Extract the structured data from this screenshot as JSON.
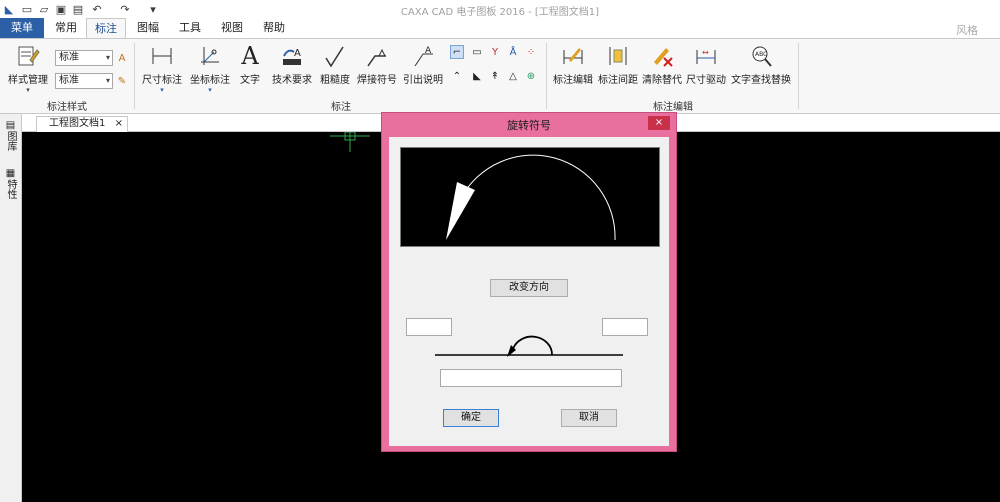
{
  "app": {
    "title": "CAXA CAD 电子图板 2016 - [工程图文档1]",
    "user_label": "风格"
  },
  "quick_access": [
    "new-file-icon",
    "open-folder-icon",
    "save-icon",
    "print-icon",
    "undo-icon",
    "redo-icon",
    "customize-icon"
  ],
  "menu": {
    "tabs": [
      {
        "label": "菜单"
      },
      {
        "label": "常用"
      },
      {
        "label": "标注"
      },
      {
        "label": "图幅"
      },
      {
        "label": "工具"
      },
      {
        "label": "视图"
      },
      {
        "label": "帮助"
      }
    ],
    "active_tab": "标注"
  },
  "ribbon": {
    "style_group": {
      "label": "标注样式",
      "manage_label": "样式管理",
      "combo1": "标准",
      "combo2": "标准"
    },
    "annot_group": {
      "label": "标注",
      "buttons": [
        {
          "label": "尺寸标注"
        },
        {
          "label": "坐标标注"
        },
        {
          "label": "文字"
        },
        {
          "label": "技术要求"
        },
        {
          "label": "粗糙度"
        },
        {
          "label": "焊接符号"
        },
        {
          "label": "引出说明"
        }
      ]
    },
    "edit_group": {
      "label": "标注编辑",
      "buttons": [
        {
          "label": "标注编辑"
        },
        {
          "label": "标注间距"
        },
        {
          "label": "清除替代"
        },
        {
          "label": "尺寸驱动"
        },
        {
          "label": "文字查找替换"
        }
      ]
    }
  },
  "document": {
    "tab_label": "工程图文档1",
    "close_label": "×"
  },
  "side_panel": {
    "tabs": [
      {
        "label": "图库"
      },
      {
        "label": "特性"
      }
    ]
  },
  "dialog": {
    "title": "旋转符号",
    "close_label": "×",
    "change_direction": "改变方向",
    "ok": "确定",
    "cancel": "取消",
    "left_value": "",
    "right_value": "",
    "text_value": ""
  },
  "colors": {
    "accent": "#2b5fa6",
    "dialog_border": "#e96f9f",
    "close_red": "#c9314a",
    "canvas": "#000000"
  }
}
